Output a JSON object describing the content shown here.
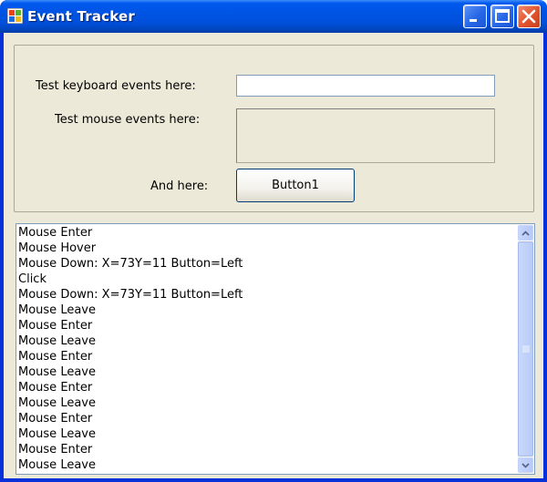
{
  "window": {
    "title": "Event Tracker"
  },
  "form": {
    "keyboard_label": "Test keyboard events here:",
    "keyboard_value": "",
    "mouse_label": "Test mouse events here:",
    "and_here_label": "And here:",
    "button_label": "Button1"
  },
  "log": {
    "items": [
      "Mouse Enter",
      "Mouse Hover",
      "Mouse Down: X=73Y=11 Button=Left",
      "Click",
      "Mouse Down: X=73Y=11 Button=Left",
      "Mouse Leave",
      "Mouse Enter",
      "Mouse Leave",
      "Mouse Enter",
      "Mouse Leave",
      "Mouse Enter",
      "Mouse Leave",
      "Mouse Enter",
      "Mouse Leave",
      "Mouse Enter",
      "Mouse Leave"
    ]
  },
  "colors": {
    "titlebar": "#0054e3",
    "client_bg": "#ece9d8",
    "close_button": "#e2532e"
  },
  "icons": {
    "app": "windows-app-icon",
    "minimize": "minimize-icon",
    "maximize": "maximize-icon",
    "close": "close-icon"
  }
}
